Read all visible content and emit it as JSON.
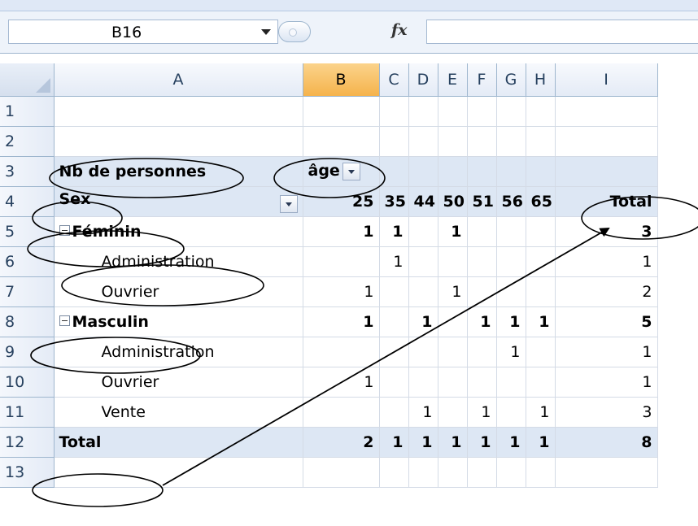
{
  "namebox": {
    "value": "B16"
  },
  "formula_bar": {
    "fx_label": "fx",
    "value": ""
  },
  "columns": [
    "A",
    "B",
    "C",
    "D",
    "E",
    "F",
    "G",
    "H",
    "I"
  ],
  "active_column": "B",
  "row_numbers": [
    "1",
    "2",
    "3",
    "4",
    "5",
    "6",
    "7",
    "8",
    "9",
    "10",
    "11",
    "12",
    "13"
  ],
  "pivot": {
    "title": "Nb de personnes",
    "col_field": "âge",
    "row_field": "Sex",
    "col_headers": [
      "25",
      "35",
      "44",
      "50",
      "51",
      "56",
      "65",
      "Total"
    ],
    "rows": [
      {
        "label": "Féminin",
        "level": 0,
        "values": [
          "1",
          "1",
          "",
          "1",
          "",
          "",
          "",
          "3"
        ]
      },
      {
        "label": "Administration",
        "level": 1,
        "values": [
          "",
          "1",
          "",
          "",
          "",
          "",
          "",
          "1"
        ]
      },
      {
        "label": "Ouvrier",
        "level": 1,
        "values": [
          "1",
          "",
          "",
          "1",
          "",
          "",
          "",
          "2"
        ]
      },
      {
        "label": "Masculin",
        "level": 0,
        "values": [
          "1",
          "",
          "1",
          "",
          "1",
          "1",
          "1",
          "5"
        ]
      },
      {
        "label": "Administration",
        "level": 1,
        "values": [
          "",
          "",
          "",
          "",
          "",
          "1",
          "",
          "1"
        ]
      },
      {
        "label": "Ouvrier",
        "level": 1,
        "values": [
          "1",
          "",
          "",
          "",
          "",
          "",
          "",
          "1"
        ]
      },
      {
        "label": "Vente",
        "level": 1,
        "values": [
          "",
          "",
          "1",
          "",
          "1",
          "",
          "1",
          "3"
        ]
      }
    ],
    "total": {
      "label": "Total",
      "values": [
        "2",
        "1",
        "1",
        "1",
        "1",
        "1",
        "1",
        "8"
      ]
    }
  }
}
